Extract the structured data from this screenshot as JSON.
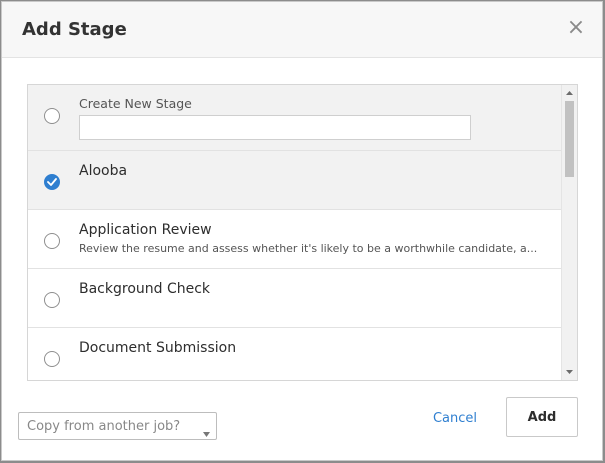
{
  "dialog": {
    "title": "Add Stage",
    "close_symbol": "×",
    "close_icon": "close-icon"
  },
  "new_stage": {
    "label": "Create New Stage",
    "value": "",
    "placeholder": ""
  },
  "stages": [
    {
      "name": "Alooba",
      "description": "",
      "selected": true
    },
    {
      "name": "Application Review",
      "description": "Review the resume and assess whether it's likely to be a worthwhile candidate, a...",
      "selected": false
    },
    {
      "name": "Background Check",
      "description": "",
      "selected": false
    },
    {
      "name": "Document Submission",
      "description": "",
      "selected": false
    }
  ],
  "footer": {
    "copy_select": {
      "selected": "Copy from another job?",
      "caret_icon": "caret-down-icon"
    },
    "cancel_label": "Cancel",
    "add_label": "Add"
  },
  "colors": {
    "accent": "#2f7fd0",
    "header_bg": "#f7f7f7",
    "selected_row_bg": "#f2f2f2"
  }
}
